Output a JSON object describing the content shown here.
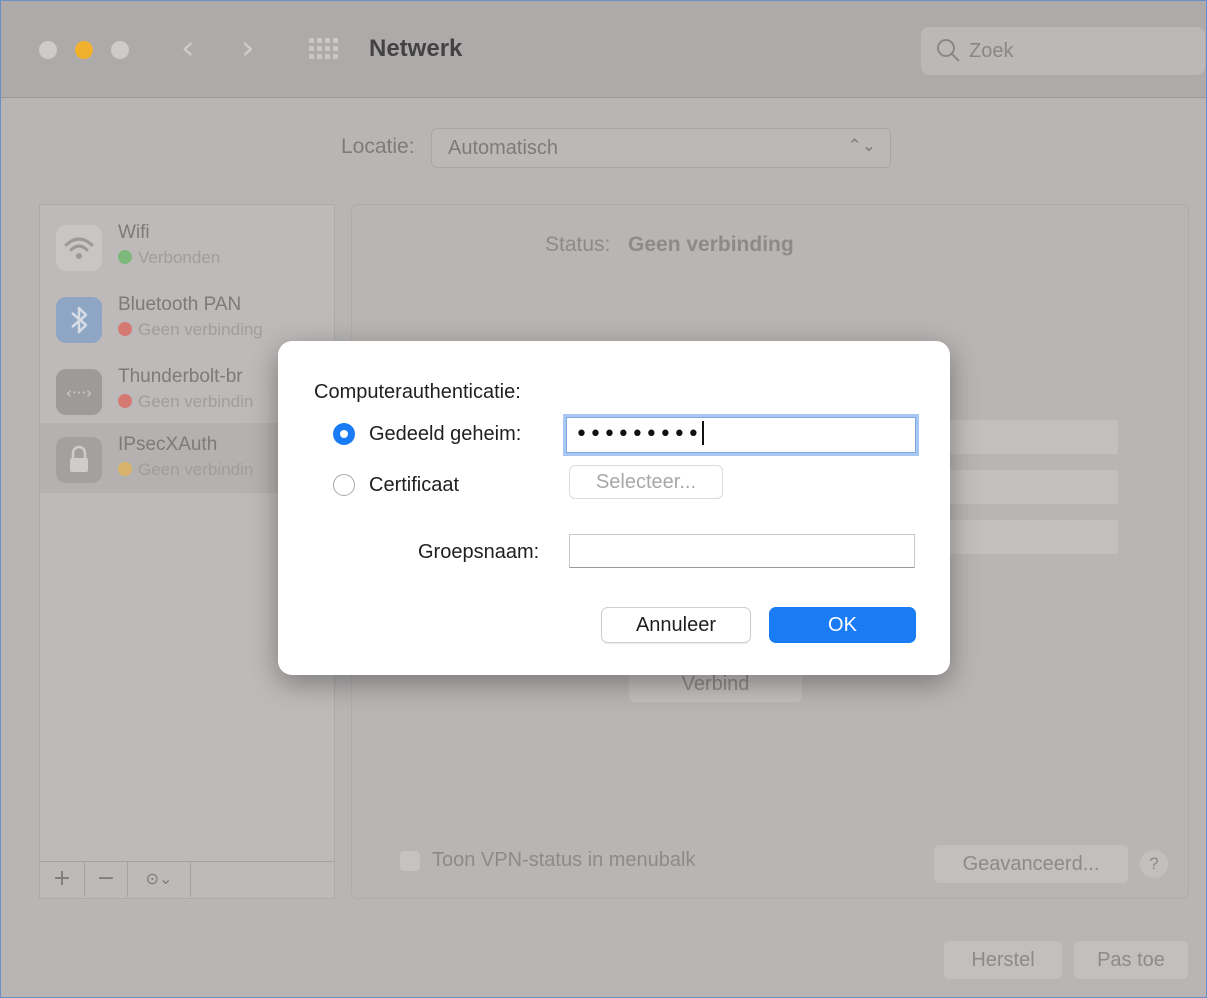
{
  "window": {
    "title": "Netwerk",
    "search_placeholder": "Zoek"
  },
  "location": {
    "label": "Locatie:",
    "value": "Automatisch"
  },
  "services": [
    {
      "name": "Wifi",
      "status": "Verbonden",
      "status_color": "#7db87d",
      "icon": "wifi-icon"
    },
    {
      "name": "Bluetooth PAN",
      "status": "Geen verbinding",
      "status_color": "#d47a73",
      "icon": "bluetooth-icon"
    },
    {
      "name": "Thunderbolt-br",
      "status": "Geen verbindin",
      "status_color": "#d47a73",
      "icon": "thunderbolt-bridge-icon"
    },
    {
      "name": "IPsecXAuth",
      "status": "Geen verbindin",
      "status_color": "#d9b36a",
      "icon": "lock-icon"
    }
  ],
  "sidebar_toolbar": {
    "add": "+",
    "remove": "−",
    "action": "⊙⌄"
  },
  "detail": {
    "status_label": "Status:",
    "status_value": "Geen verbinding",
    "connect": "Verbind",
    "vpn_status_label": "Toon VPN-status in menubalk",
    "advanced": "Geavanceerd...",
    "help": "?"
  },
  "footer": {
    "revert": "Herstel",
    "apply": "Pas toe"
  },
  "dialog": {
    "heading": "Computerauthenticatie:",
    "shared_secret_label": "Gedeeld geheim:",
    "shared_secret_value": "•••••••••",
    "certificate_label": "Certificaat",
    "select_button": "Selecteer...",
    "group_name_label": "Groepsnaam:",
    "group_name_value": "",
    "cancel": "Annuleer",
    "ok": "OK",
    "selected_option": "shared_secret"
  },
  "colors": {
    "accent": "#1a7cf5",
    "minimize": "#f2b12d"
  }
}
